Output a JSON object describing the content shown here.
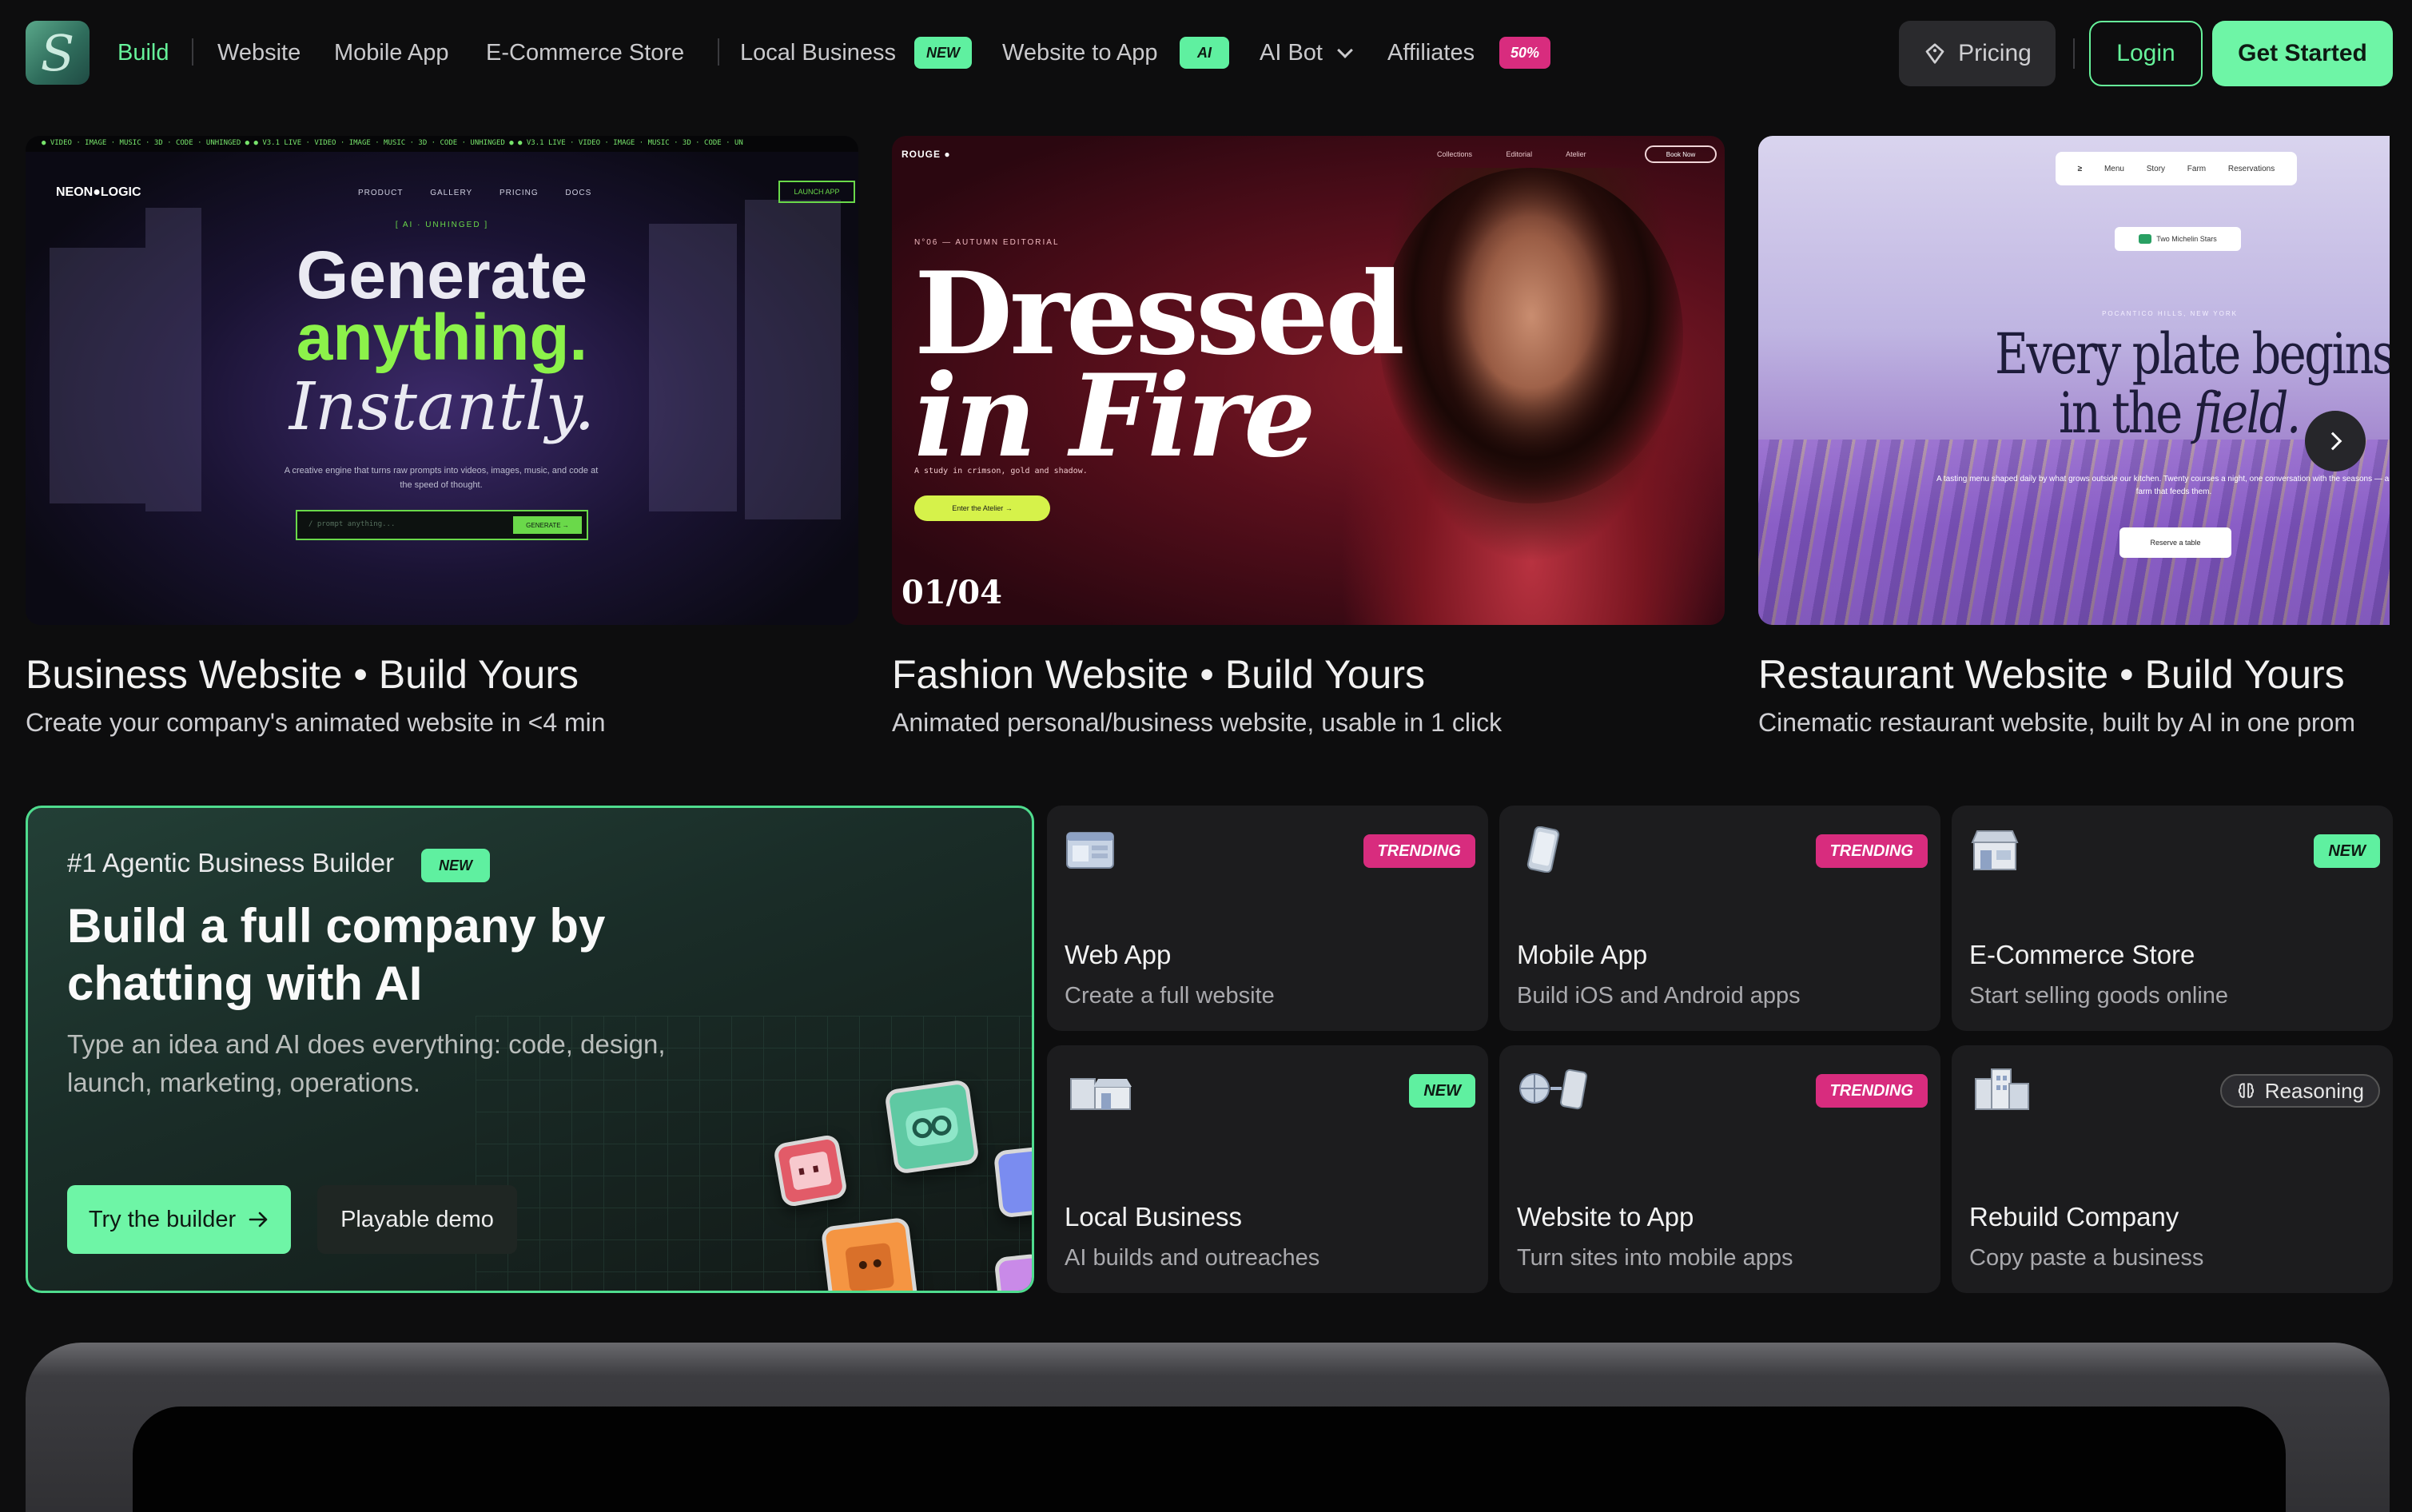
{
  "nav": {
    "items": [
      {
        "label": "Build"
      },
      {
        "label": "Website"
      },
      {
        "label": "Mobile App"
      },
      {
        "label": "E-Commerce Store"
      },
      {
        "label": "Local Business",
        "badge": "NEW"
      },
      {
        "label": "Website to App",
        "badge": "AI"
      },
      {
        "label": "AI Bot"
      },
      {
        "label": "Affiliates",
        "badge": "50%"
      }
    ],
    "pricing": "Pricing",
    "login": "Login",
    "get_started": "Get Started"
  },
  "showcase": [
    {
      "title": "Business Website • Build Yours",
      "subtitle": "Create your company's animated website in <4 min",
      "preview": {
        "ticker": "● VIDEO · IMAGE · MUSIC · 3D · CODE · UNHINGED ● ● V3.1 LIVE · VIDEO · IMAGE · MUSIC · 3D · CODE · UNHINGED ● ● V3.1 LIVE · VIDEO · IMAGE · MUSIC · 3D · CODE · UN",
        "brand": "NEON●LOGIC",
        "menu": [
          "PRODUCT",
          "GALLERY",
          "PRICING",
          "DOCS"
        ],
        "launch": "LAUNCH APP",
        "tag": "[ AI · UNHINGED ]",
        "h1": "Generate",
        "h2": "anything.",
        "h3": "Instantly.",
        "desc": "A creative engine that turns raw prompts into videos, images, music, and code at the speed of thought.",
        "prompt_placeholder": "/ prompt anything...",
        "generate": "GENERATE →"
      }
    },
    {
      "title": "Fashion Website • Build Yours",
      "subtitle": "Animated personal/business website, usable in 1 click",
      "preview": {
        "brand": "ROUGE ●",
        "menu": [
          "Collections",
          "Editorial",
          "Atelier"
        ],
        "book": "Book Now",
        "edition": "N°06 — AUTUMN EDITORIAL",
        "t1": "Dressed",
        "t2": "in Fire",
        "small": "A study in crimson, gold and shadow.",
        "cta": "Enter the Atelier →",
        "count": "01/04"
      }
    },
    {
      "title": "Restaurant Website • Build Yours",
      "subtitle": "Cinematic restaurant website, built by AI in one prom",
      "preview": {
        "menu": [
          "Menu",
          "Story",
          "Farm",
          "Reservations"
        ],
        "badge": "Two Michelin Stars",
        "location": "POCANTICO HILLS, NEW YORK",
        "t1": "Every plate begins",
        "t2a": "in the ",
        "t2b": "field.",
        "desc": "A tasting menu shaped daily by what grows outside our kitchen. Twenty courses a night, one conversation with the seasons — and the farm that feeds them.",
        "reserve": "Reserve a table"
      }
    }
  ],
  "hero": {
    "kicker": "#1 Agentic Business Builder",
    "badge": "NEW",
    "title": "Build a full company by chatting with AI",
    "description": "Type an idea and AI does everything: code, design, launch, marketing, operations.",
    "try_label": "Try the builder",
    "demo_label": "Playable demo"
  },
  "features": [
    {
      "name": "Web App",
      "sub": "Create a full website",
      "badge": "TRENDING",
      "icon": "browser-window-icon"
    },
    {
      "name": "Mobile App",
      "sub": "Build iOS and Android apps",
      "badge": "TRENDING",
      "icon": "phone-icon"
    },
    {
      "name": "E-Commerce Store",
      "sub": "Start selling goods online",
      "badge": "NEW",
      "icon": "storefront-icon"
    },
    {
      "name": "Local Business",
      "sub": "AI builds and outreaches",
      "badge": "NEW",
      "icon": "local-shop-icon"
    },
    {
      "name": "Website to App",
      "sub": "Turn sites into mobile apps",
      "badge": "TRENDING",
      "icon": "globe-to-phone-icon"
    },
    {
      "name": "Rebuild Company",
      "sub": "Copy paste a business",
      "badge": "Reasoning",
      "icon": "buildings-icon"
    }
  ],
  "colors": {
    "accent": "#66f29a",
    "pink": "#d82c7e",
    "background": "#0d0d0e",
    "card": "#1c1c1e"
  }
}
